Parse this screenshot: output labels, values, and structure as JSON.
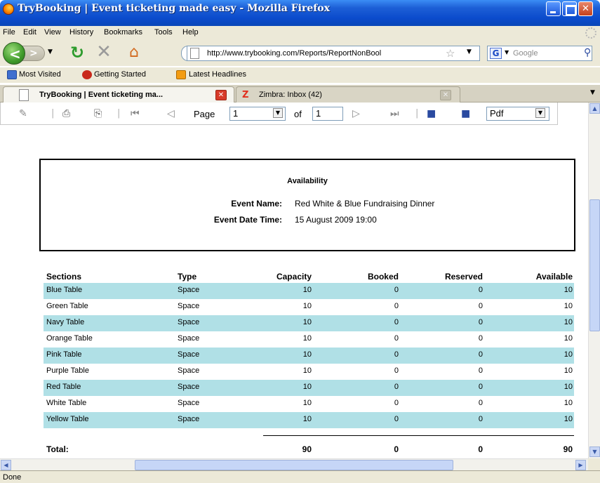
{
  "window": {
    "title": "TryBooking | Event ticketing made easy - Mozilla Firefox"
  },
  "menu": [
    "File",
    "Edit",
    "View",
    "History",
    "Bookmarks",
    "Tools",
    "Help"
  ],
  "nav": {
    "url": "http://www.trybooking.com/Reports/ReportNonBool",
    "search_placeholder": "Google",
    "search_engine_letter": "G"
  },
  "bookmarks": [
    "Most Visited",
    "Getting Started",
    "Latest Headlines"
  ],
  "tabs": [
    {
      "label": "TryBooking | Event ticketing ma...",
      "active": true
    },
    {
      "label": "Zimbra: Inbox (42)",
      "active": false
    }
  ],
  "report_toolbar": {
    "page_label": "Page",
    "page_value": "1",
    "of_label": "of",
    "total_pages": "1",
    "export_format": "Pdf"
  },
  "report": {
    "title": "Availability",
    "event_name_label": "Event Name:",
    "event_name": "Red White & Blue Fundraising Dinner",
    "event_datetime_label": "Event Date Time:",
    "event_datetime": "15 August 2009 19:00",
    "columns": [
      "Sections",
      "Type",
      "Capacity",
      "Booked",
      "Reserved",
      "Available"
    ],
    "rows": [
      [
        "Blue Table",
        "Space",
        "10",
        "0",
        "0",
        "10"
      ],
      [
        "Green Table",
        "Space",
        "10",
        "0",
        "0",
        "10"
      ],
      [
        "Navy Table",
        "Space",
        "10",
        "0",
        "0",
        "10"
      ],
      [
        "Orange Table",
        "Space",
        "10",
        "0",
        "0",
        "10"
      ],
      [
        "Pink Table",
        "Space",
        "10",
        "0",
        "0",
        "10"
      ],
      [
        "Purple Table",
        "Space",
        "10",
        "0",
        "0",
        "10"
      ],
      [
        "Red Table",
        "Space",
        "10",
        "0",
        "0",
        "10"
      ],
      [
        "White Table",
        "Space",
        "10",
        "0",
        "0",
        "10"
      ],
      [
        "Yellow Table",
        "Space",
        "10",
        "0",
        "0",
        "10"
      ]
    ],
    "total": {
      "label": "Total:",
      "capacity": "90",
      "booked": "0",
      "reserved": "0",
      "available": "90"
    }
  },
  "status": "Done",
  "colors": {
    "row_shade": "#b0e0e6",
    "titlebar": "#0b4bcc"
  }
}
